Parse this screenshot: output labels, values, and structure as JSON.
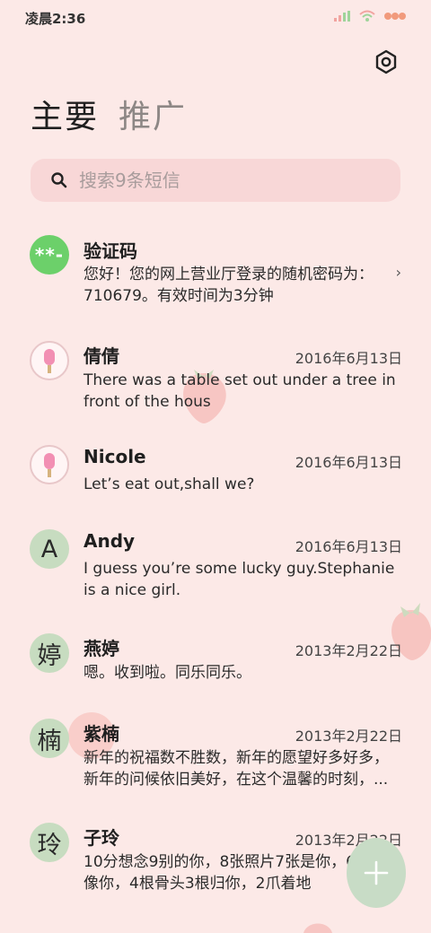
{
  "status": {
    "time": "凌晨2:36"
  },
  "tabs": {
    "primary": "主要",
    "promo": "推广"
  },
  "search": {
    "placeholder": "搜索9条短信"
  },
  "messages": [
    {
      "avatar": "**-",
      "name": "验证码",
      "date": "",
      "preview": "您好！您的网上营业厅登录的随机密码为：710679。有效时间为3分钟"
    },
    {
      "avatar": "",
      "name": "倩倩",
      "date": "2016年6月13日",
      "preview": "There was a table set out under a tree in front of the hous"
    },
    {
      "avatar": "",
      "name": "Nicole",
      "date": "2016年6月13日",
      "preview": "Let’s eat out,shall we?"
    },
    {
      "avatar": "A",
      "name": "Andy",
      "date": "2016年6月13日",
      "preview": "I guess you’re some lucky guy.Stephanie is a nice girl."
    },
    {
      "avatar": "婷",
      "name": "燕婷",
      "date": "2013年2月22日",
      "preview": "嗯。收到啦。同乐同乐。"
    },
    {
      "avatar": "楠",
      "name": "紫楠",
      "date": "2013年2月22日",
      "preview": "新年的祝福数不胜数，新年的愿望好多好多，新年的问候依旧美好，在这个温馨的时刻，..."
    },
    {
      "avatar": "玲",
      "name": "子玲",
      "date": "2013年2月22日",
      "preview": "10分想念9别的你，8张照片7张是你，6狗5只像你，4根骨头3根归你，2爪着地"
    }
  ],
  "colors": {
    "background": "#fce9e7",
    "search_bg": "#f8d7d7",
    "avatar_green": "#c7dcc0",
    "code_green": "#6cd06a"
  },
  "icons": {
    "settings": "gear-icon",
    "search": "search-icon",
    "compose": "plus-icon"
  }
}
